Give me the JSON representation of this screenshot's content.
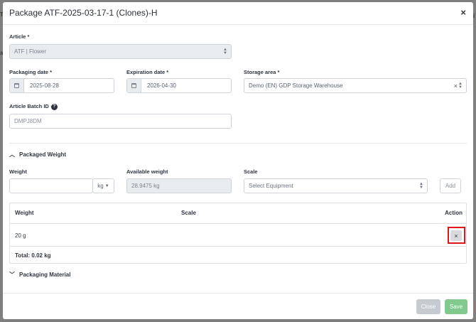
{
  "window": {
    "title": "Package ATF-2025-03-17-1 (Clones)-H",
    "close_glyph": "×"
  },
  "form": {
    "article": {
      "label": "Article",
      "value": "ATF | Flower"
    },
    "packaging_date": {
      "label": "Packaging date",
      "value": "2025-08-28"
    },
    "expiration_date": {
      "label": "Expiration date",
      "value": "2026-04-30"
    },
    "storage_area": {
      "label": "Storage area",
      "value": "Demo (EN) GDP Storage Warehouse"
    },
    "batch_id": {
      "label": "Article Batch ID",
      "placeholder": "DMPJ8DM"
    },
    "required_mark": "*"
  },
  "packaged_weight": {
    "section_label": "Packaged Weight",
    "weight_label": "Weight",
    "unit": "kg",
    "available_label": "Available weight",
    "available_value": "28.9475 kg",
    "scale_label": "Scale",
    "scale_placeholder": "Select Equipment",
    "add_label": "Add",
    "table": {
      "headers": [
        "Weight",
        "Scale",
        "Action"
      ],
      "rows": [
        {
          "weight": "20 g",
          "scale": ""
        }
      ],
      "total": "Total: 0.02 kg"
    }
  },
  "packaging_material": {
    "section_label": "Packaging Material"
  },
  "footer": {
    "close_label": "Close",
    "save_label": "Save"
  },
  "colors": {
    "save": "#82c98d",
    "close": "#c6cbd1",
    "highlight": "#e0161c"
  }
}
